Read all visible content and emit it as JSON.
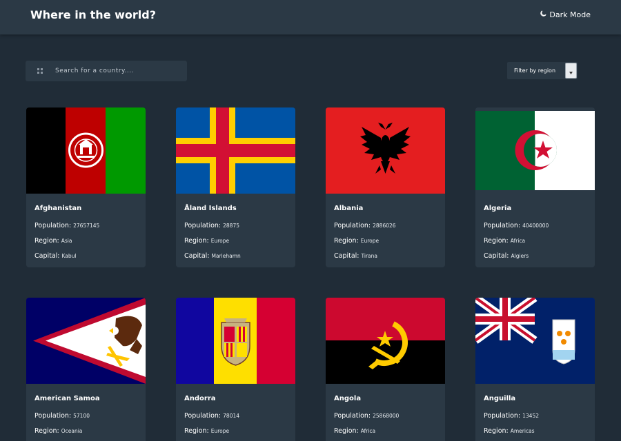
{
  "header": {
    "title": "Where in the world?",
    "dark_mode_label": "Dark Mode"
  },
  "search": {
    "placeholder": "Search for a country....",
    "icon": "search-icon"
  },
  "filter": {
    "label": "Filter by region"
  },
  "labels": {
    "population": "Population:",
    "region": "Region:",
    "capital": "Capital:"
  },
  "countries": [
    {
      "name": "Afghanistan",
      "population": "27657145",
      "region": "Asia",
      "capital": "Kabul"
    },
    {
      "name": "Åland Islands",
      "population": "28875",
      "region": "Europe",
      "capital": "Mariehamn"
    },
    {
      "name": "Albania",
      "population": "2886026",
      "region": "Europe",
      "capital": "Tirana"
    },
    {
      "name": "Algeria",
      "population": "40400000",
      "region": "Africa",
      "capital": "Algiers"
    },
    {
      "name": "American Samoa",
      "population": "57100",
      "region": "Oceania",
      "capital": ""
    },
    {
      "name": "Andorra",
      "population": "78014",
      "region": "Europe",
      "capital": ""
    },
    {
      "name": "Angola",
      "population": "25868000",
      "region": "Africa",
      "capital": ""
    },
    {
      "name": "Anguilla",
      "population": "13452",
      "region": "Americas",
      "capital": ""
    }
  ]
}
